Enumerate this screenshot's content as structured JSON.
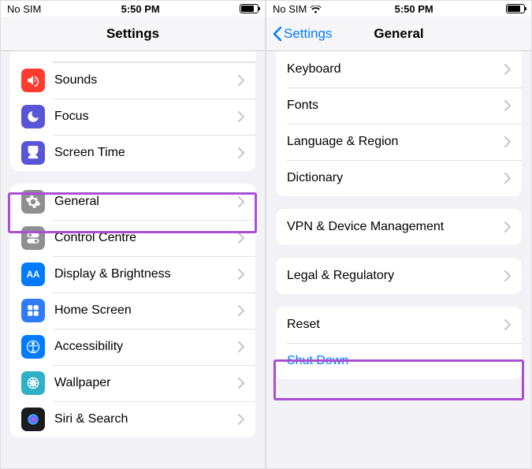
{
  "left": {
    "status": {
      "carrier": "No SIM",
      "time": "5:50 PM"
    },
    "title": "Settings",
    "group1": [
      {
        "label": "Sounds",
        "icon": "sounds"
      },
      {
        "label": "Focus",
        "icon": "focus"
      },
      {
        "label": "Screen Time",
        "icon": "screentime"
      }
    ],
    "group2": [
      {
        "label": "General",
        "icon": "general"
      },
      {
        "label": "Control Centre",
        "icon": "controlcentre"
      },
      {
        "label": "Display & Brightness",
        "icon": "display"
      },
      {
        "label": "Home Screen",
        "icon": "homescreen"
      },
      {
        "label": "Accessibility",
        "icon": "accessibility"
      },
      {
        "label": "Wallpaper",
        "icon": "wallpaper"
      },
      {
        "label": "Siri & Search",
        "icon": "siri"
      }
    ]
  },
  "right": {
    "status": {
      "carrier": "No SIM",
      "time": "5:50 PM"
    },
    "back": "Settings",
    "title": "General",
    "group1": [
      {
        "label": "Keyboard"
      },
      {
        "label": "Fonts"
      },
      {
        "label": "Language & Region"
      },
      {
        "label": "Dictionary"
      }
    ],
    "group2": [
      {
        "label": "VPN & Device Management"
      }
    ],
    "group3": [
      {
        "label": "Legal & Regulatory"
      }
    ],
    "group4": [
      {
        "label": "Reset"
      },
      {
        "label": "Shut Down",
        "blue": true,
        "nochev": true
      }
    ]
  }
}
